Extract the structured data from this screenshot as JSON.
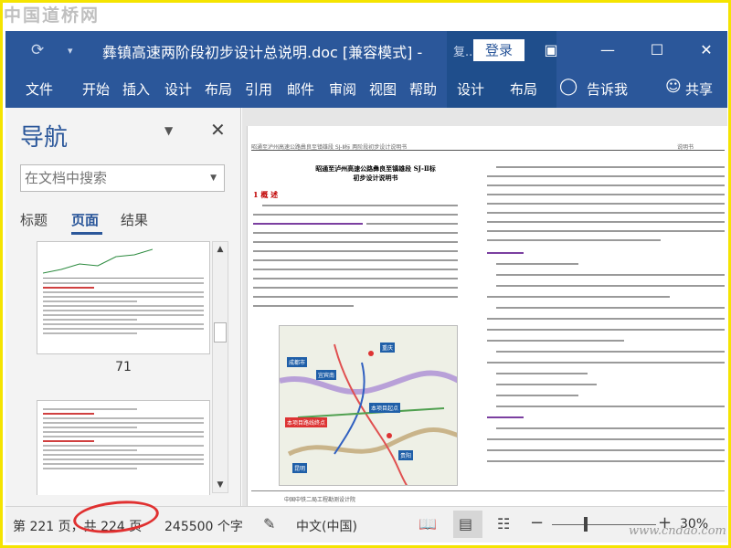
{
  "watermark": {
    "top": "中国道桥网",
    "bottom": "www.cndao.com"
  },
  "window": {
    "title": "彝镇高速两阶段初步设计总说明.doc [兼容模式]  -",
    "context_label": "复...",
    "login": "登录",
    "buttons": {
      "ribbon_display": "▣",
      "minimize": "—",
      "maximize": "☐",
      "close": "✕"
    }
  },
  "ribbon": {
    "tabs": [
      "文件",
      "开始",
      "插入",
      "设计",
      "布局",
      "引用",
      "邮件",
      "审阅",
      "视图",
      "帮助",
      "设计",
      "布局"
    ],
    "tell_me": "告诉我",
    "share": "共享"
  },
  "nav": {
    "title": "导航",
    "search_placeholder": "在文档中搜索",
    "tabs": [
      "标题",
      "页面",
      "结果"
    ],
    "active_tab": "页面",
    "page_number_label": "71"
  },
  "document": {
    "header_left": "昭通至泸州高速公路彝良至镇雄段 SJ-Ⅱ标 两阶段初步设计说明书",
    "header_right": "说明书",
    "heading_line1": "昭通至泸州高速公路彝良至镇雄段 SJ-Ⅱ标",
    "heading_line2": "初步设计说明书",
    "section": "1  概  述",
    "map_labels": [
      "成都市",
      "宜宾南",
      "重庆",
      "本项目起点",
      "本项目路线终点",
      "昆明",
      "贵阳"
    ],
    "footer": "中国中铁二局工程勘测设计院"
  },
  "status": {
    "page_info": "第 221 页，共 224 页",
    "word_count": "245500 个字",
    "language": "中文(中国)",
    "zoom": "30%"
  },
  "colors": {
    "accent": "#2b579a",
    "highlight": "#e03030",
    "frame": "#f5e400"
  }
}
